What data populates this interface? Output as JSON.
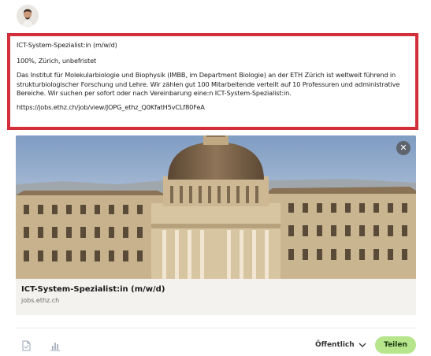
{
  "post": {
    "lines": {
      "title": "ICT-System-Spezialist:in (m/w/d)",
      "workload": "100%, Zürich, unbefristet",
      "description": "Das Institut für Molekularbiologie und Biophysik (IMBB, im Department Biologie) an der ETH Zürich ist weltweit führend in strukturbiologischer Forschung und Lehre. Wir zählen gut 100 Mitarbeitende verteilt auf 10 Professuren und administrative Bereiche. Wir suchen per sofort oder nach Vereinbarung eine:n ICT-System-Spezialist:in.",
      "url": "https://jobs.ethz.ch/job/view/JOPG_ethz_Q0KfatH5vCLf80FeA"
    }
  },
  "link_preview": {
    "title": "ICT-System-Spezialist:in (m/w/d)",
    "domain": "jobs.ethz.ch",
    "close_icon": "✕",
    "image_icon": "eth-main-building-photo"
  },
  "footer": {
    "visibility_label": "Öffentlich",
    "post_label": "Teilen",
    "icons": [
      "document-icon",
      "chart-icon",
      "chevron-down-icon"
    ],
    "accent_color": "#b6e58c",
    "highlight_color": "#d32f3a"
  }
}
